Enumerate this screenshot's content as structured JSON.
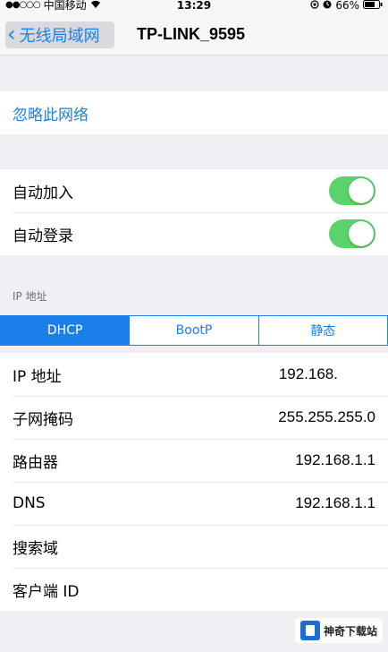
{
  "status_bar": {
    "signal": "●●○○○",
    "carrier": "中国移动",
    "time": "13:29",
    "battery": "66%"
  },
  "nav": {
    "back_label": "无线局域网",
    "title": "TP-LINK_9595"
  },
  "forget": {
    "label": "忽略此网络"
  },
  "toggles": [
    {
      "label": "自动加入",
      "on": true
    },
    {
      "label": "自动登录",
      "on": true
    }
  ],
  "ip_section": {
    "header": "IP 地址",
    "segments": [
      "DHCP",
      "BootP",
      "静态"
    ],
    "selected": "DHCP"
  },
  "ip_rows": [
    {
      "label": "IP 地址",
      "value": "192.168."
    },
    {
      "label": "子网掩码",
      "value": "255.255.255.0"
    },
    {
      "label": "路由器",
      "value": "192.168.1.1"
    },
    {
      "label": "DNS",
      "value": "192.168.1.1"
    },
    {
      "label": "搜索域",
      "value": ""
    },
    {
      "label": "客户端 ID",
      "value": ""
    }
  ],
  "watermark": {
    "text": "神奇下载站"
  },
  "colors": {
    "accent": "#1a7fe8",
    "toggle_on": "#5bd36b",
    "background": "#efeff4"
  }
}
